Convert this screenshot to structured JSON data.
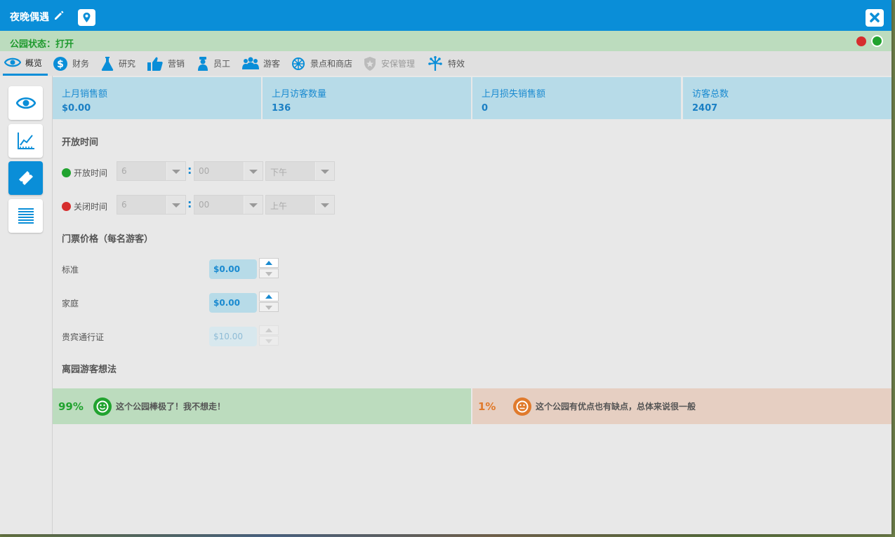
{
  "window": {
    "title": "夜晚偶遇"
  },
  "status": {
    "text": "公园状态：打开"
  },
  "tabs": [
    {
      "label": "概览",
      "icon": "eye-icon"
    },
    {
      "label": "财务",
      "icon": "dollar-icon"
    },
    {
      "label": "研究",
      "icon": "flask-icon"
    },
    {
      "label": "营销",
      "icon": "thumbs-up-icon"
    },
    {
      "label": "员工",
      "icon": "staff-icon"
    },
    {
      "label": "游客",
      "icon": "guests-icon"
    },
    {
      "label": "景点和商店",
      "icon": "ferris-wheel-icon"
    },
    {
      "label": "安保管理",
      "icon": "shield-icon"
    },
    {
      "label": "特效",
      "icon": "fireworks-icon"
    }
  ],
  "sidebar": [
    {
      "icon": "eye-icon"
    },
    {
      "icon": "line-chart-icon"
    },
    {
      "icon": "ticket-icon"
    },
    {
      "icon": "list-icon"
    }
  ],
  "stats": [
    {
      "label": "上月销售额",
      "value": "$0.00"
    },
    {
      "label": "上月访客数量",
      "value": "136"
    },
    {
      "label": "上月损失销售额",
      "value": "0"
    },
    {
      "label": "访客总数",
      "value": "2407"
    }
  ],
  "opening_hours": {
    "heading": "开放时间",
    "open": {
      "label": "开放时间",
      "hour": "6",
      "minute": "00",
      "ampm": "下午"
    },
    "close": {
      "label": "关闭时间",
      "hour": "6",
      "minute": "00",
      "ampm": "上午"
    },
    "separator": ":"
  },
  "ticket_prices": {
    "heading": "门票价格（每名游客）",
    "standard": {
      "label": "标准",
      "value": "$0.00"
    },
    "family": {
      "label": "家庭",
      "value": "$0.00"
    },
    "vip": {
      "label": "贵宾通行证",
      "value": "$10.00"
    }
  },
  "thoughts": {
    "heading": "离园游客想法",
    "positive": {
      "percent": "99%",
      "text": "这个公园棒极了！我不想走！"
    },
    "neutral": {
      "percent": "1%",
      "text": "这个公园有优点也有缺点，总体来说很一般"
    }
  },
  "colors": {
    "accent": "#0a8ed8",
    "open_green": "#21a32f",
    "close_red": "#d62e2e",
    "positive_bg": "#bcdcbe",
    "neutral_bg": "#e6cfc2",
    "neutral_text": "#e07a2c"
  }
}
